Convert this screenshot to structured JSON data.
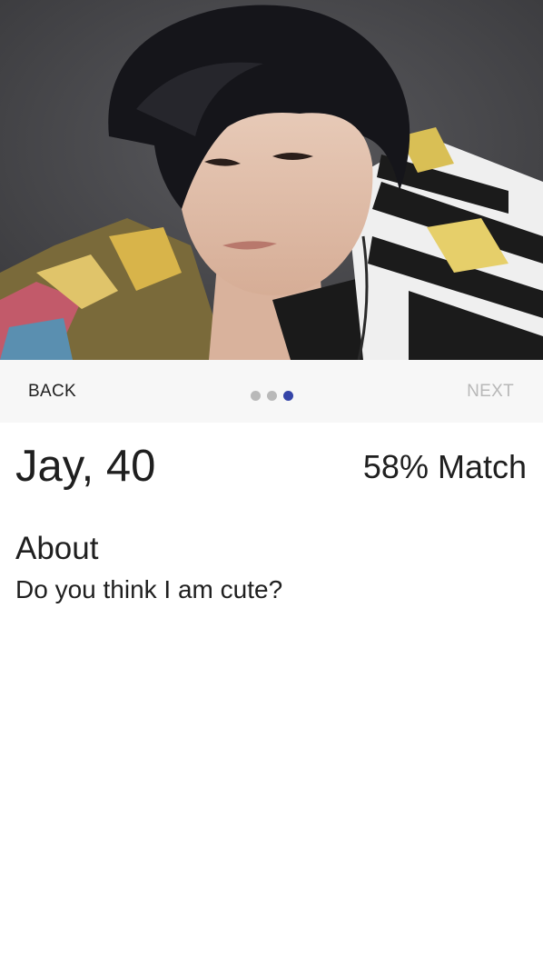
{
  "profile": {
    "photo_alt": "profile-photo",
    "name_age": "Jay, 40",
    "match": "58% Match",
    "about_heading": "About",
    "about_text": "Do you think I am cute?"
  },
  "stepper": {
    "back_label": "BACK",
    "next_label": "NEXT",
    "total_steps": 3,
    "active_step": 3
  },
  "colors": {
    "dot_inactive": "#b9b9b9",
    "dot_active": "#3545a8",
    "next_disabled": "#b8b8b8",
    "stepper_bg": "#f7f7f7"
  }
}
